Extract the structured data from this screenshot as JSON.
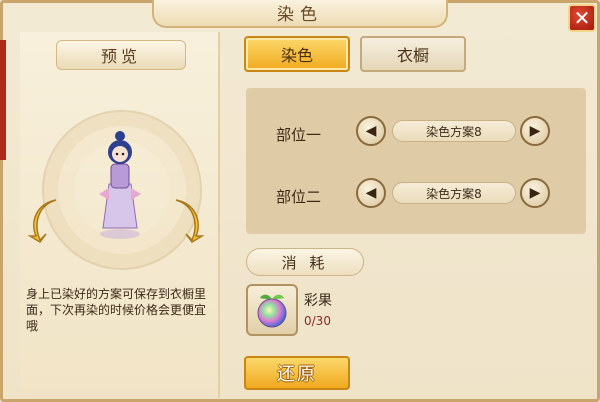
{
  "window": {
    "title": "染色",
    "close_icon": "close-icon"
  },
  "preview": {
    "label": "预览",
    "description": "身上已染好的方案可保存到衣橱里面，下次再染的时候价格会更便宜哦",
    "rotate_left_icon": "rotate-left-arrow-icon",
    "rotate_right_icon": "rotate-right-arrow-icon"
  },
  "tabs": [
    {
      "label": "染色",
      "active": true
    },
    {
      "label": "衣橱",
      "active": false
    }
  ],
  "parts": [
    {
      "label": "部位一",
      "scheme": "染色方案8"
    },
    {
      "label": "部位二",
      "scheme": "染色方案8"
    }
  ],
  "cost": {
    "label": "消 耗",
    "item_name": "彩果",
    "item_count": "0/30",
    "item_icon": "rainbow-fruit-icon"
  },
  "actions": {
    "restore_label": "还原"
  },
  "colors": {
    "accent_gold": "#f0a91f",
    "panel_bg": "#efe3c8",
    "close_red": "#b02a1a"
  }
}
